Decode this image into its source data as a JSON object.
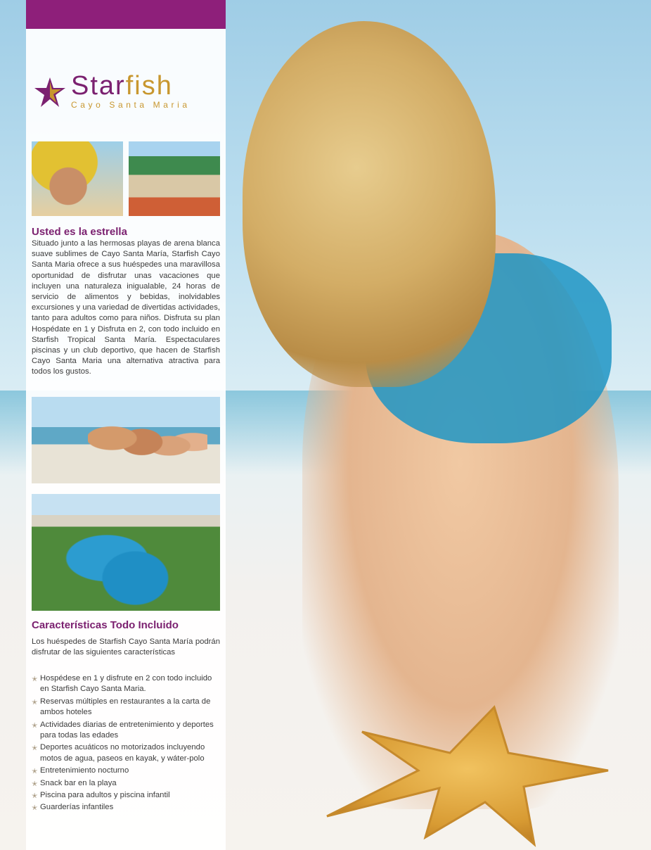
{
  "brand": {
    "name_part1": "Star",
    "name_part2": "fish",
    "subtitle": "Cayo Santa Maria",
    "colors": {
      "purple": "#8e1f7a",
      "gold": "#c8972f"
    }
  },
  "section1": {
    "heading": "Usted es la estrella",
    "body": "Situado junto a las hermosas playas de arena blanca suave sublimes de Cayo Santa María, Starfish Cayo Santa Maria ofrece a sus huéspedes una maravillosa oportunidad de disfrutar unas vacaciones que incluyen una naturaleza inigualable, 24 horas de servicio de alimentos y bebidas, inolvidables excursiones y una variedad de divertidas actividades, tanto para adultos como para niños. Disfruta su plan Hospédate en 1 y Disfruta en 2, con todo incluido en Starfish Tropical Santa María. Espectaculares piscinas y un club deportivo, que hacen de Starfish Cayo Santa Maria una alternativa atractiva para todos los gustos."
  },
  "section2": {
    "heading": "Características Todo Incluido",
    "intro": "Los huéspedes de Starfish Cayo Santa María podrán disfrutar de las siguientes características",
    "items": [
      "Hospédese en 1 y disfrute en 2 con todo incluido en Starfish Cayo Santa Maria.",
      "Reservas múltiples en restaurantes a la carta de ambos hoteles",
      "Actividades diarias de entretenimiento y deportes para todas las edades",
      "Deportes acuáticos no motorizados incluyendo motos de agua, paseos en kayak, y wáter-polo",
      "Entretenimiento nocturno",
      "Snack bar en la playa",
      "Piscina para adultos y piscina infantil",
      "Guarderías infantiles"
    ],
    "bullet_icon": "star-icon"
  }
}
